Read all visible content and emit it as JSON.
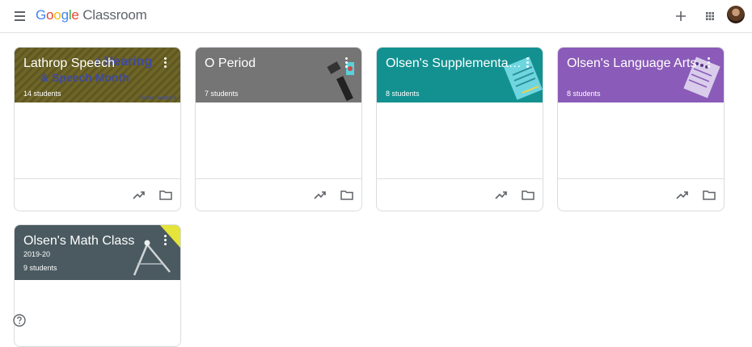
{
  "header": {
    "logo_google": "Google",
    "logo_product": "Classroom",
    "icons": [
      "menu-icon",
      "plus-icon",
      "apps-grid-icon",
      "avatar"
    ]
  },
  "colors": {
    "google_blue": "#4285F4",
    "google_red": "#EA4335",
    "google_yellow": "#FBBC05",
    "google_green": "#34A853",
    "card_olive": "#6b6226",
    "card_gray": "#757575",
    "card_teal": "#129190",
    "card_purple": "#8a5bb8",
    "card_slate": "#4a5a60"
  },
  "classes": [
    {
      "name": "Lathrop Speech",
      "section": "",
      "students": "14 students",
      "banner_text_1": "r Hearing",
      "banner_text_2": "& Speech Month",
      "banner_text_3": "Better Hearing &"
    },
    {
      "name": "O Period",
      "section": "",
      "students": "7 students"
    },
    {
      "name": "Olsen's Supplemental Reading",
      "section": "",
      "students": "8 students"
    },
    {
      "name": "Olsen's Language Arts",
      "section": "",
      "students": "8 students"
    },
    {
      "name": "Olsen's Math Class",
      "section": "2019-20",
      "students": "9 students"
    }
  ],
  "footer_icons": [
    "trending-icon",
    "folder-icon"
  ],
  "help_icon": "help-icon"
}
